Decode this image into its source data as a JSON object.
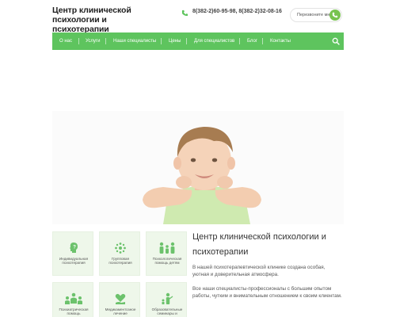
{
  "header": {
    "logo_text": "Центр клинической психологии и психотерапии",
    "phone": "8(382-2)60-95-98, 8(382-2)32-08-16",
    "callback_label": "Перезвоните мне"
  },
  "nav": {
    "items": [
      "О нас",
      "Услуги",
      "Наши специалисты",
      "Цены",
      "Для специалистов",
      "Блог",
      "Контакты"
    ],
    "accent_color": "#5ec45e"
  },
  "services": [
    {
      "label": "Индивидуальная психотерапия",
      "icon": "head-question-icon"
    },
    {
      "label": "Групповая психотерапия",
      "icon": "group-circle-icon"
    },
    {
      "label": "Психологическая помощь детям",
      "icon": "family-icon"
    },
    {
      "label": "Психиатрическая помощь",
      "icon": "people-hands-icon"
    },
    {
      "label": "Медикаментозное лечение",
      "icon": "heart-hand-icon"
    },
    {
      "label": "Образовательные семинары и",
      "icon": "presenter-icon"
    }
  ],
  "intro": {
    "title": "Центр клинической психологии и психотерапии",
    "paragraph1": "В нашей психотерапевтической  клинике создана особая, уютная и доверительная атмосфера.",
    "paragraph2": "Все наши специалисты-профессионалы с большим опытом работы, чутким и внимательным отношением к своим клиентам."
  }
}
